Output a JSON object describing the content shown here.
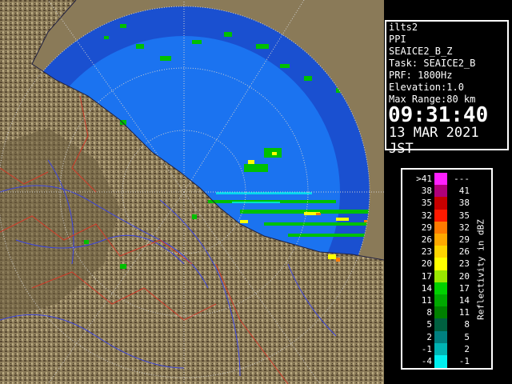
{
  "info": {
    "site": "ilts2",
    "mode": "PPI",
    "product": "SEAICE2_B_Z",
    "task": "Task: SEAICE2_B",
    "prf": "PRF: 1800Hz",
    "elevation": "Elevation:1.0",
    "max_range": "Max Range:80 km",
    "time": "09:31:40",
    "date": "13 MAR 2021 JST"
  },
  "legend": {
    "unit": "Reflectivity in dBZ",
    "rows": [
      {
        "lo": ">41",
        "hi": "---",
        "color": "#ff20ff"
      },
      {
        "lo": "38",
        "hi": "41",
        "color": "#b0007a"
      },
      {
        "lo": "35",
        "hi": "38",
        "color": "#c80000"
      },
      {
        "lo": "32",
        "hi": "35",
        "color": "#ff1a00"
      },
      {
        "lo": "29",
        "hi": "32",
        "color": "#ff7a00"
      },
      {
        "lo": "26",
        "hi": "29",
        "color": "#ffa800"
      },
      {
        "lo": "23",
        "hi": "26",
        "color": "#ffd400"
      },
      {
        "lo": "20",
        "hi": "23",
        "color": "#ffff00"
      },
      {
        "lo": "17",
        "hi": "20",
        "color": "#99e800"
      },
      {
        "lo": "14",
        "hi": "17",
        "color": "#00d000"
      },
      {
        "lo": "11",
        "hi": "14",
        "color": "#00a800"
      },
      {
        "lo": "8",
        "hi": "11",
        "color": "#008000"
      },
      {
        "lo": "5",
        "hi": "8",
        "color": "#006040"
      },
      {
        "lo": "2",
        "hi": "5",
        "color": "#008080"
      },
      {
        "lo": "-1",
        "hi": "2",
        "color": "#00b4b4"
      },
      {
        "lo": "-4",
        "hi": "-1",
        "color": "#00f0f0"
      }
    ]
  },
  "colors": {
    "sea_far": "#1a50d0",
    "sea_near": "#1b73f0",
    "land": "#8a7a58",
    "rivers": "#3a44e0",
    "boundaries": "#d23a28",
    "rings": "#cfcfcf"
  }
}
